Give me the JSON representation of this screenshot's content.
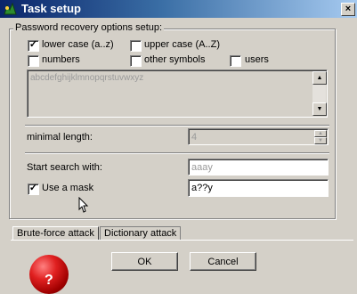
{
  "window": {
    "title": "Task setup",
    "close_glyph": "×"
  },
  "group": {
    "legend": "Password recovery options setup:"
  },
  "charsets": [
    {
      "label": "lower case (a..z)",
      "checked": true
    },
    {
      "label": "upper case (A..Z)",
      "checked": false
    },
    {
      "label": "numbers",
      "checked": false
    },
    {
      "label": "other symbols",
      "checked": false
    },
    {
      "label": "users",
      "checked": false
    }
  ],
  "charset_preview": "abcdefghijklmnopqrstuvwxyz",
  "min_length": {
    "label": "minimal length:",
    "value": "4"
  },
  "start_search": {
    "label": "Start search with:",
    "value": "aaay"
  },
  "mask": {
    "label": "Use a mask",
    "checked": true,
    "value": "a??y"
  },
  "tabs": [
    {
      "label": "Brute-force attack",
      "active": true
    },
    {
      "label": "Dictionary attack",
      "active": false
    }
  ],
  "buttons": {
    "ok": "OK",
    "cancel": "Cancel"
  },
  "logo_text": "?"
}
